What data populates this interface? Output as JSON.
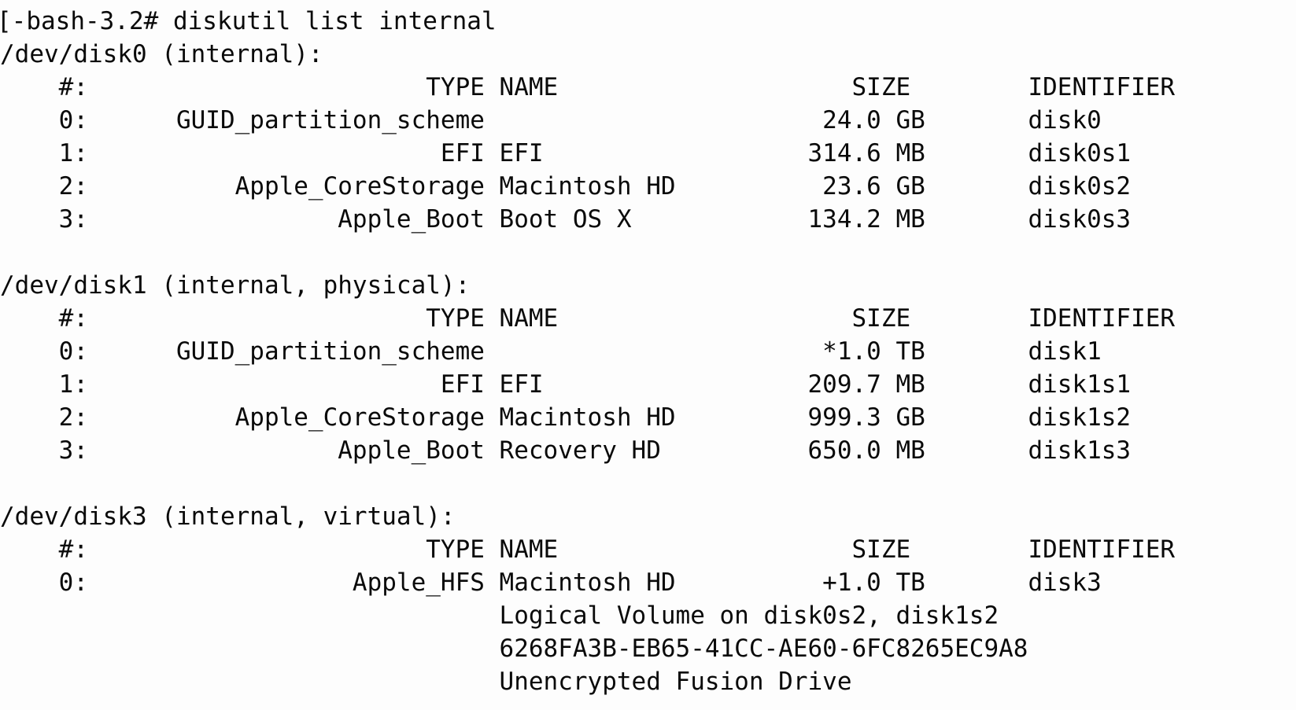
{
  "terminal": {
    "prompt": "[-bash-3.2#",
    "command": "diskutil list internal",
    "prompt_line": "[-bash-3.2# diskutil list internal",
    "columns": {
      "index": "#:",
      "type": "TYPE",
      "name": "NAME",
      "size": "SIZE",
      "identifier": "IDENTIFIER"
    },
    "sections": [
      {
        "device": "/dev/disk0 (internal):",
        "rows": [
          {
            "index": "0:",
            "type": "GUID_partition_scheme",
            "name": "",
            "size": "24.0 GB",
            "identifier": "disk0"
          },
          {
            "index": "1:",
            "type": "EFI",
            "name": "EFI",
            "size": "314.6 MB",
            "identifier": "disk0s1"
          },
          {
            "index": "2:",
            "type": "Apple_CoreStorage",
            "name": "Macintosh HD",
            "size": "23.6 GB",
            "identifier": "disk0s2"
          },
          {
            "index": "3:",
            "type": "Apple_Boot",
            "name": "Boot OS X",
            "size": "134.2 MB",
            "identifier": "disk0s3"
          }
        ],
        "notes": []
      },
      {
        "device": "/dev/disk1 (internal, physical):",
        "rows": [
          {
            "index": "0:",
            "type": "GUID_partition_scheme",
            "name": "",
            "size": "*1.0 TB",
            "identifier": "disk1"
          },
          {
            "index": "1:",
            "type": "EFI",
            "name": "EFI",
            "size": "209.7 MB",
            "identifier": "disk1s1"
          },
          {
            "index": "2:",
            "type": "Apple_CoreStorage",
            "name": "Macintosh HD",
            "size": "999.3 GB",
            "identifier": "disk1s2"
          },
          {
            "index": "3:",
            "type": "Apple_Boot",
            "name": "Recovery HD",
            "size": "650.0 MB",
            "identifier": "disk1s3"
          }
        ],
        "notes": []
      },
      {
        "device": "/dev/disk3 (internal, virtual):",
        "rows": [
          {
            "index": "0:",
            "type": "Apple_HFS",
            "name": "Macintosh HD",
            "size": "+1.0 TB",
            "identifier": "disk3"
          }
        ],
        "notes": [
          "Logical Volume on disk0s2, disk1s2",
          "6268FA3B-EB65-41CC-AE60-6FC8265EC9A8",
          "Unencrypted Fusion Drive"
        ]
      }
    ]
  }
}
